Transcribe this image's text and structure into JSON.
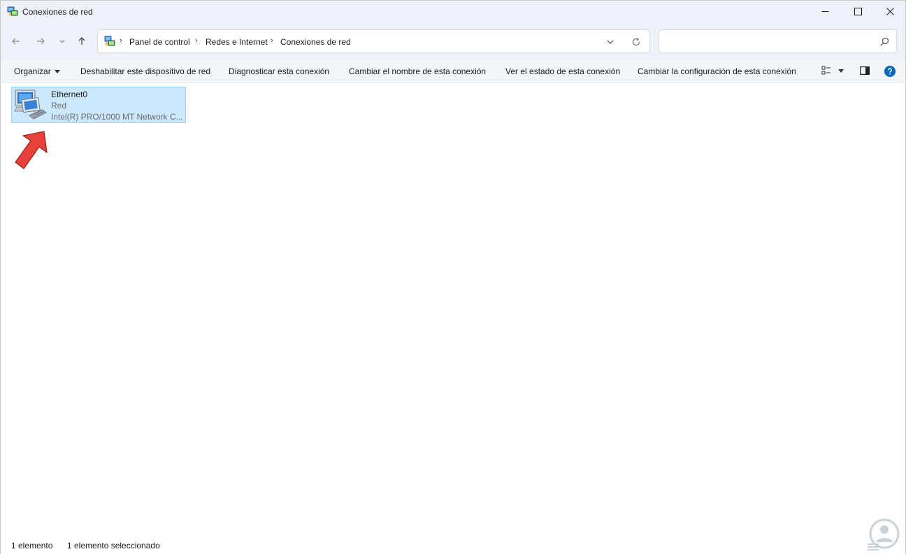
{
  "window": {
    "title": "Conexiones de red",
    "icon": "network-connections-icon"
  },
  "address": {
    "icon": "control-panel-icon",
    "crumbs": [
      "Panel de control",
      "Redes e Internet",
      "Conexiones de red"
    ],
    "search_placeholder": ""
  },
  "toolbar": {
    "organize": "Organizar",
    "disable": "Deshabilitar este dispositivo de red",
    "diagnose": "Diagnosticar esta conexión",
    "rename": "Cambiar el nombre de esta conexión",
    "view_status": "Ver el estado de esta conexión",
    "change_settings": "Cambiar la configuración de esta conexión"
  },
  "items": [
    {
      "name": "Ethernet0",
      "status": "Red",
      "adapter": "Intel(R) PRO/1000 MT Network C...",
      "icon": "ethernet-adapter-icon",
      "selected": true
    }
  ],
  "statusbar": {
    "count": "1 elemento",
    "selected": "1 elemento seleccionado"
  },
  "colors": {
    "selection": "#cce8ff",
    "selection_border": "#99d1ff",
    "arrow": "#e8413c",
    "help": "#0067c0"
  }
}
